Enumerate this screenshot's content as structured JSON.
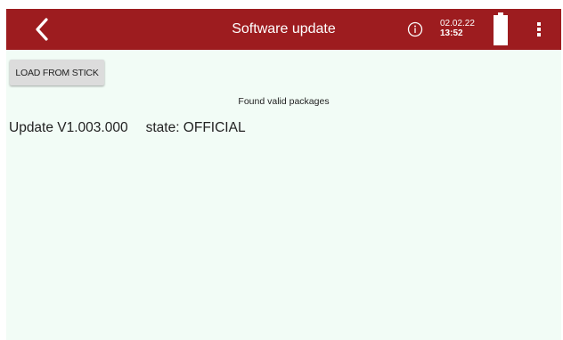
{
  "header": {
    "title": "Software update",
    "date": "02.02.22",
    "time": "13:52",
    "back_icon": "chevron-left-icon",
    "info_icon": "info-circle-icon",
    "battery_icon": "battery-full-icon",
    "menu_icon": "more-vertical-icon"
  },
  "actions": {
    "load_button_label": "LOAD FROM STICK"
  },
  "main": {
    "status_message": "Found valid packages",
    "packages": [
      {
        "name": "Update V1.003.000",
        "state": "state: OFFICIAL"
      }
    ]
  },
  "colors": {
    "header_background": "#9d1c1f",
    "content_background": "#f2fcf6",
    "button_background": "#dcdcdc"
  }
}
